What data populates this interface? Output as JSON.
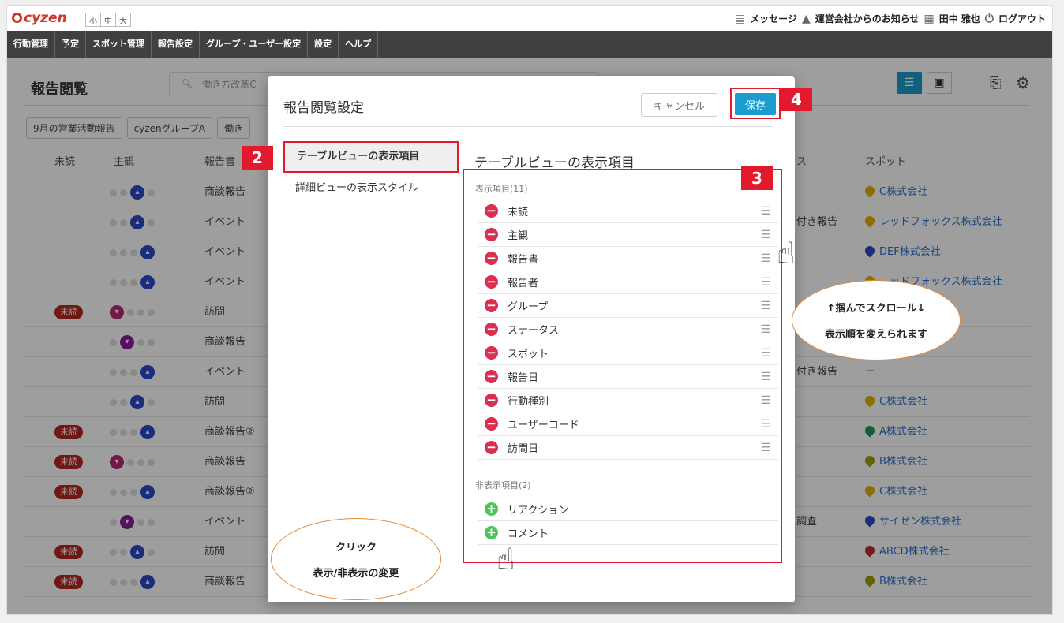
{
  "header": {
    "logo": "cyzen",
    "font_sizes": [
      "小",
      "中",
      "大"
    ],
    "message": "メッセージ",
    "notice": "運営会社からのお知らせ",
    "user": "田中 雅也",
    "logout": "ログアウト"
  },
  "nav": [
    "行動管理",
    "予定",
    "スポット管理",
    "報告設定",
    "グループ・ユーザー設定",
    "設定",
    "ヘルプ"
  ],
  "page": {
    "title": "報告閲覧",
    "search_value": "働き方改革C",
    "filters": [
      "9月の営業活動報告",
      "cyzenグループA",
      "働き"
    ]
  },
  "table": {
    "headers": [
      "未読",
      "主観",
      "報告書",
      "ス",
      "スポット"
    ],
    "rows": [
      {
        "unread": "",
        "level": 3,
        "report": "商談報告",
        "status": "",
        "spot": "C株式会社",
        "pin_color": "#e0b000"
      },
      {
        "unread": "",
        "level": 3,
        "report": "イベント",
        "status": "付き報告",
        "spot": "レッドフォックス株式会社",
        "pin_color": "#e0b000"
      },
      {
        "unread": "",
        "level": 4,
        "report": "イベント",
        "status": "",
        "spot": "DEF株式会社",
        "pin_color": "#2a47c6"
      },
      {
        "unread": "",
        "level": 4,
        "report": "イベント",
        "status": "",
        "spot": "レッドフォックス株式会社",
        "pin_color": "#e0b000"
      },
      {
        "unread": "未読",
        "level": 1,
        "report": "訪問",
        "status": "",
        "spot": "",
        "pin_color": ""
      },
      {
        "unread": "",
        "level": 2,
        "report": "商談報告",
        "status": "",
        "spot": "",
        "pin_color": ""
      },
      {
        "unread": "",
        "level": 4,
        "report": "イベント",
        "status": "付き報告",
        "spot": "－",
        "pin_color": ""
      },
      {
        "unread": "",
        "level": 3,
        "report": "訪問",
        "status": "",
        "spot": "C株式会社",
        "pin_color": "#e0b000"
      },
      {
        "unread": "未読",
        "level": 4,
        "report": "商談報告②",
        "status": "",
        "spot": "A株式会社",
        "pin_color": "#1a9c5a"
      },
      {
        "unread": "未読",
        "level": 1,
        "report": "商談報告",
        "status": "",
        "spot": "B株式会社",
        "pin_color": "#a0a000"
      },
      {
        "unread": "未読",
        "level": 4,
        "report": "商談報告②",
        "status": "",
        "spot": "C株式会社",
        "pin_color": "#e0b000"
      },
      {
        "unread": "",
        "level": 2,
        "report": "イベント",
        "status": "調査",
        "spot": "サイゼン株式会社",
        "pin_color": "#2a47c6"
      },
      {
        "unread": "未読",
        "level": 3,
        "report": "訪問",
        "status": "",
        "spot": "ABCD株式会社",
        "pin_color": "#c02a2a"
      },
      {
        "unread": "未読",
        "level": 4,
        "report": "商談報告",
        "status": "",
        "spot": "B株式会社",
        "pin_color": "#a0a000"
      }
    ]
  },
  "modal": {
    "title": "報告閲覧設定",
    "cancel": "キャンセル",
    "save": "保存",
    "side_items": [
      "テーブルビューの表示項目",
      "詳細ビューの表示スタイル"
    ],
    "section_title": "テーブルビューの表示項目",
    "shown_label": "表示項目(11)",
    "shown_items": [
      "未読",
      "主観",
      "報告書",
      "報告者",
      "グループ",
      "ステータス",
      "スポット",
      "報告日",
      "行動種別",
      "ユーザーコード",
      "訪問日"
    ],
    "hidden_label": "非表示項目(2)",
    "hidden_items": [
      "リアクション",
      "コメント"
    ]
  },
  "annotations": {
    "badges": [
      "2",
      "3",
      "4"
    ],
    "drag_line1": "↑掴んでスクロール↓",
    "drag_line2": "表示順を変えられます",
    "click_line1": "クリック",
    "click_line2": "表示/非表示の変更"
  }
}
